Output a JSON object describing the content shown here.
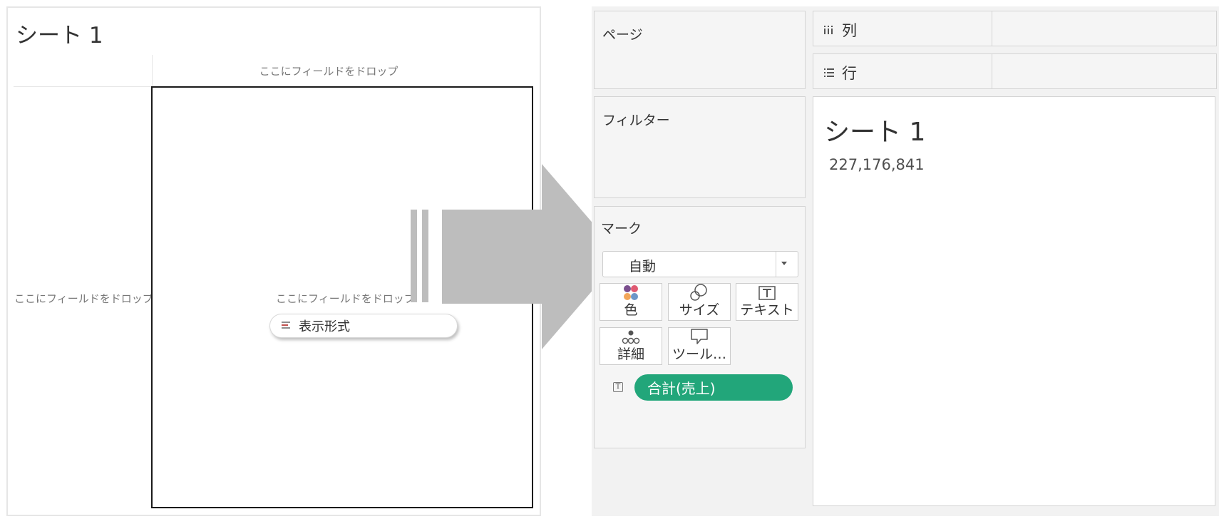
{
  "left_sheet": {
    "title": "シート 1",
    "column_drop_hint": "ここにフィールドをドロップ",
    "row_drop_hint": "ここにフィールドをドロップ",
    "view_drop_hint": "ここにフィールドをドロップ",
    "dragged_pill": {
      "label": "表示形式",
      "icon": "text-format-icon"
    }
  },
  "arrow": {
    "icon": "big-right-arrow-icon",
    "color": "#bdbdbd"
  },
  "right_workspace": {
    "pages_card": {
      "title": "ページ"
    },
    "filters_card": {
      "title": "フィルター"
    },
    "marks_card": {
      "title": "マーク",
      "mark_type": {
        "selected": "自動",
        "icon": "chevron-down-icon"
      },
      "buttons": [
        {
          "label": "色",
          "icon": "color-dots-icon"
        },
        {
          "label": "サイズ",
          "icon": "size-circles-icon"
        },
        {
          "label": "テキスト",
          "icon": "text-t-icon"
        },
        {
          "label": "詳細",
          "icon": "detail-dots-icon"
        },
        {
          "label": "ツール…",
          "icon": "tooltip-bubble-icon"
        }
      ],
      "field_pill": {
        "label": "合計(売上)",
        "color": "#22a67a",
        "icon": "text-t-icon"
      }
    },
    "columns_shelf": {
      "label": "列",
      "icon": "columns-icon"
    },
    "rows_shelf": {
      "label": "行",
      "icon": "rows-icon"
    },
    "sheet": {
      "title": "シート 1",
      "value": "227,176,841"
    }
  },
  "colors": {
    "accent_green": "#22a67a",
    "color_dots": [
      "#7b4f8e",
      "#e05a72",
      "#f2a65a",
      "#6c96c8"
    ]
  }
}
